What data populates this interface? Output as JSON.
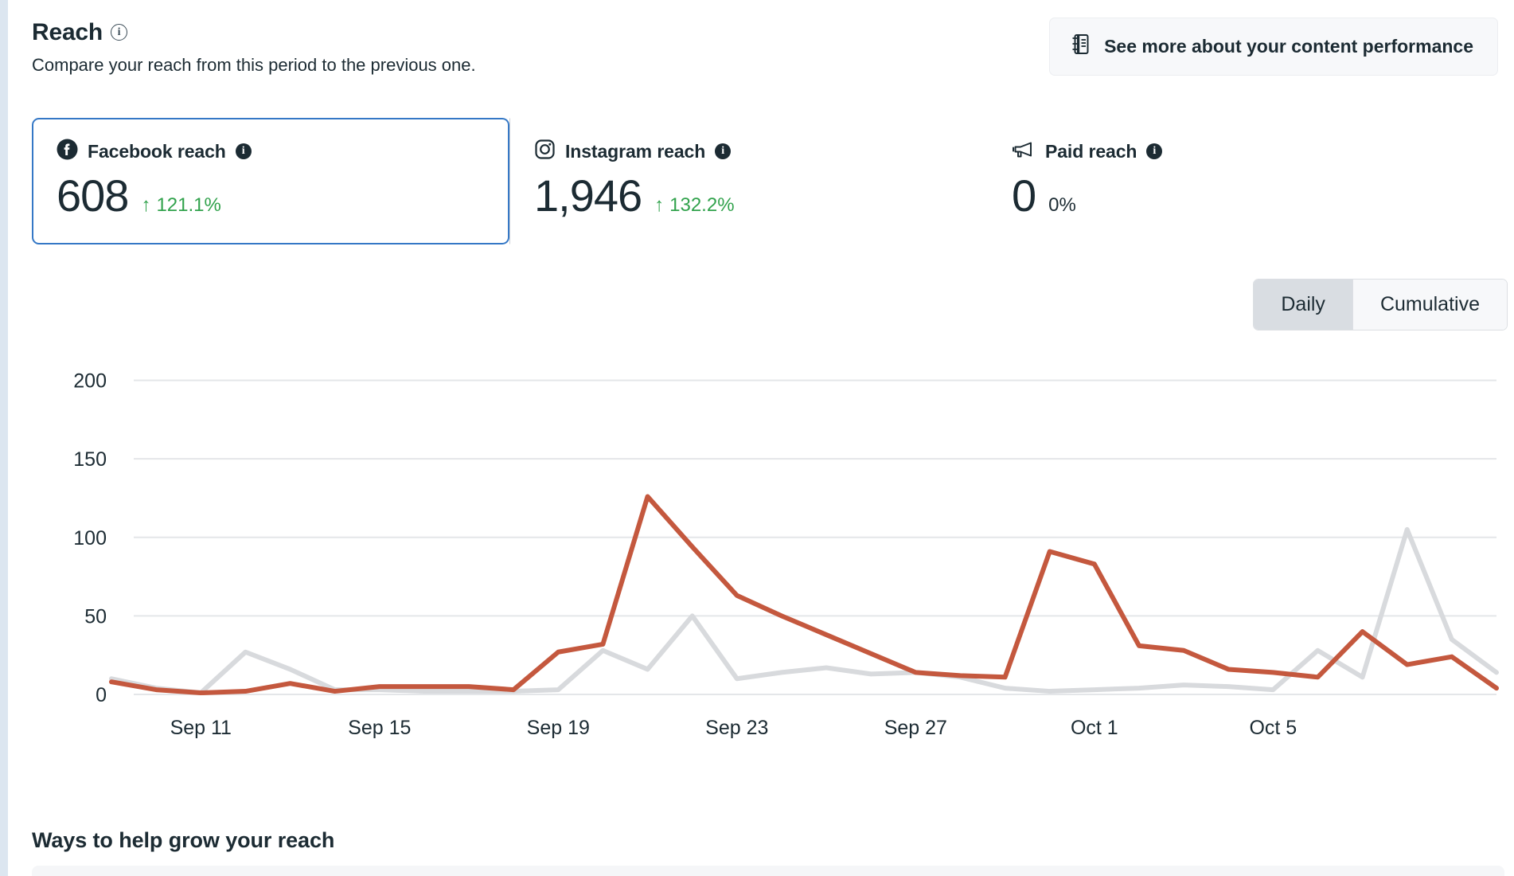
{
  "section": {
    "title": "Reach",
    "subtitle": "Compare your reach from this period to the previous one.",
    "info_glyph": "i"
  },
  "see_more": {
    "label": "See more about your content performance",
    "icon": "journal-icon"
  },
  "metrics": [
    {
      "icon": "facebook-icon",
      "label": "Facebook reach",
      "value": "608",
      "delta": "121.1%",
      "arrow": "↑",
      "selected": true
    },
    {
      "icon": "instagram-icon",
      "label": "Instagram reach",
      "value": "1,946",
      "delta": "132.2%",
      "arrow": "↑",
      "selected": false
    },
    {
      "icon": "megaphone-icon",
      "label": "Paid reach",
      "value": "0",
      "delta": "0%",
      "arrow": "",
      "selected": false
    }
  ],
  "toggle": {
    "options": [
      {
        "label": "Daily",
        "active": true
      },
      {
        "label": "Cumulative",
        "active": false
      }
    ]
  },
  "footer": {
    "title": "Ways to help grow your reach"
  },
  "colors": {
    "current_line": "#c4583e",
    "previous_line": "#d8dadd",
    "selected_border": "#3578c6",
    "positive": "#31a24c",
    "text": "#1c2b33",
    "grid": "#e4e6e9"
  },
  "chart_data": {
    "type": "line",
    "title": "",
    "xlabel": "",
    "ylabel": "",
    "ylim": [
      0,
      215
    ],
    "yticks": [
      0,
      50,
      100,
      150,
      200
    ],
    "ytick_labels": [
      "0",
      "50",
      "100",
      "150",
      "200"
    ],
    "grid": true,
    "legend": "none",
    "x": [
      "Sep 9",
      "Sep 10",
      "Sep 11",
      "Sep 12",
      "Sep 13",
      "Sep 14",
      "Sep 15",
      "Sep 16",
      "Sep 17",
      "Sep 18",
      "Sep 19",
      "Sep 20",
      "Sep 21",
      "Sep 22",
      "Sep 23",
      "Sep 24",
      "Sep 25",
      "Sep 26",
      "Sep 27",
      "Sep 28",
      "Sep 29",
      "Sep 30",
      "Oct 1",
      "Oct 2",
      "Oct 3",
      "Oct 4",
      "Oct 5",
      "Oct 6"
    ],
    "xtick_labels": [
      "Sep 11",
      "Sep 15",
      "Sep 19",
      "Sep 23",
      "Sep 27",
      "Oct 1",
      "Oct 5"
    ],
    "xtick_indices": [
      2,
      6,
      10,
      14,
      18,
      22,
      26
    ],
    "series": [
      {
        "name": "This period",
        "color": "#c4583e",
        "values": [
          8,
          3,
          1,
          2,
          7,
          2,
          5,
          5,
          5,
          3,
          27,
          32,
          126,
          94,
          63,
          50,
          38,
          26,
          14,
          12,
          11,
          91,
          83,
          31,
          28,
          16,
          14,
          11,
          40,
          19,
          24,
          4
        ]
      },
      {
        "name": "Previous period",
        "color": "#d8dadd",
        "values": [
          10,
          4,
          1,
          27,
          16,
          3,
          3,
          2,
          2,
          2,
          3,
          28,
          16,
          50,
          10,
          14,
          17,
          13,
          14,
          11,
          4,
          2,
          3,
          4,
          6,
          5,
          3,
          28,
          11,
          105,
          35,
          14
        ]
      }
    ],
    "series_points": {
      "current": [
        [
          0,
          8
        ],
        [
          1,
          3
        ],
        [
          2,
          1
        ],
        [
          3,
          2
        ],
        [
          4,
          7
        ],
        [
          5,
          2
        ],
        [
          6,
          5
        ],
        [
          7,
          5
        ],
        [
          8,
          5
        ],
        [
          9,
          3
        ],
        [
          10,
          27
        ],
        [
          11,
          32
        ],
        [
          12,
          126
        ],
        [
          13,
          94
        ],
        [
          14,
          63
        ],
        [
          15,
          50
        ],
        [
          16,
          38
        ],
        [
          17,
          26
        ],
        [
          18,
          14
        ],
        [
          19,
          12
        ],
        [
          20,
          11
        ],
        [
          21,
          91
        ],
        [
          22,
          83
        ],
        [
          23,
          31
        ],
        [
          24,
          28
        ],
        [
          25,
          16
        ],
        [
          26,
          14
        ],
        [
          27,
          11
        ],
        [
          28,
          40
        ],
        [
          29,
          19
        ],
        [
          30,
          24
        ],
        [
          31,
          4
        ]
      ],
      "previous": [
        [
          0,
          10
        ],
        [
          1,
          4
        ],
        [
          2,
          1
        ],
        [
          3,
          27
        ],
        [
          4,
          16
        ],
        [
          5,
          3
        ],
        [
          6,
          3
        ],
        [
          7,
          2
        ],
        [
          8,
          2
        ],
        [
          9,
          2
        ],
        [
          10,
          3
        ],
        [
          11,
          28
        ],
        [
          12,
          16
        ],
        [
          13,
          50
        ],
        [
          14,
          10
        ],
        [
          15,
          14
        ],
        [
          16,
          17
        ],
        [
          17,
          13
        ],
        [
          18,
          14
        ],
        [
          19,
          11
        ],
        [
          20,
          4
        ],
        [
          21,
          2
        ],
        [
          22,
          3
        ],
        [
          23,
          4
        ],
        [
          24,
          6
        ],
        [
          25,
          5
        ],
        [
          26,
          3
        ],
        [
          27,
          28
        ],
        [
          28,
          11
        ],
        [
          29,
          105
        ],
        [
          30,
          35
        ],
        [
          31,
          14
        ]
      ]
    }
  }
}
